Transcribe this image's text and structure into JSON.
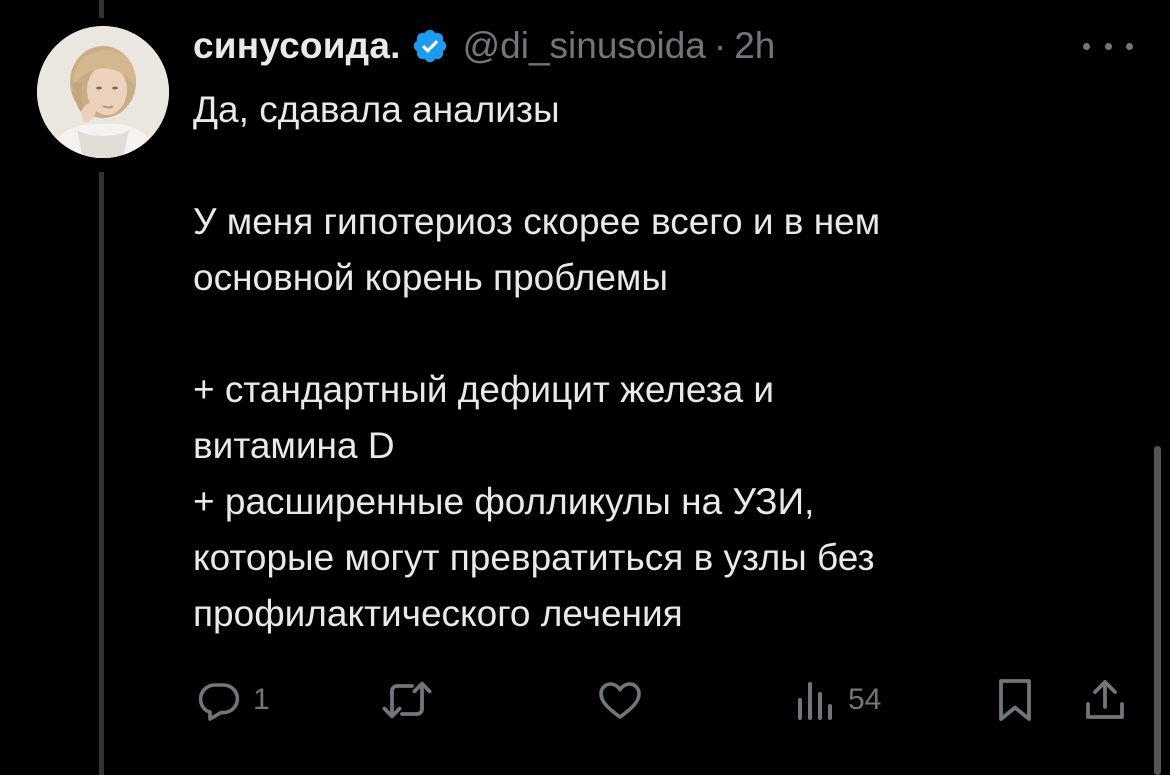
{
  "tweet": {
    "display_name": "синусоида.",
    "handle": "@di_sinusoida",
    "separator": "·",
    "time": "2h",
    "verified": true,
    "paragraphs": [
      [
        "Да, сдавала анализы"
      ],
      [
        "У меня гипотериоз скорее всего и в нем",
        "основной корень проблемы"
      ],
      [
        "+ стандартный дефицит железа и",
        "витамина D",
        "+ расширенные фолликулы на УЗИ,",
        "которые могут превратиться в узлы без",
        "профилактического лечения"
      ]
    ]
  },
  "actions": {
    "replies": "1",
    "views": "54"
  },
  "icons": {
    "verified": "verified-badge-icon",
    "more": "more-dots-icon",
    "reply": "reply-icon",
    "retweet": "retweet-icon",
    "like": "heart-icon",
    "views": "views-bar-chart-icon",
    "bookmark": "bookmark-icon",
    "share": "share-icon"
  },
  "colors": {
    "background": "#000000",
    "text": "#e7e9ea",
    "muted": "#71767b",
    "verified": "#1d9bf0",
    "thread_line": "#2f3336"
  }
}
